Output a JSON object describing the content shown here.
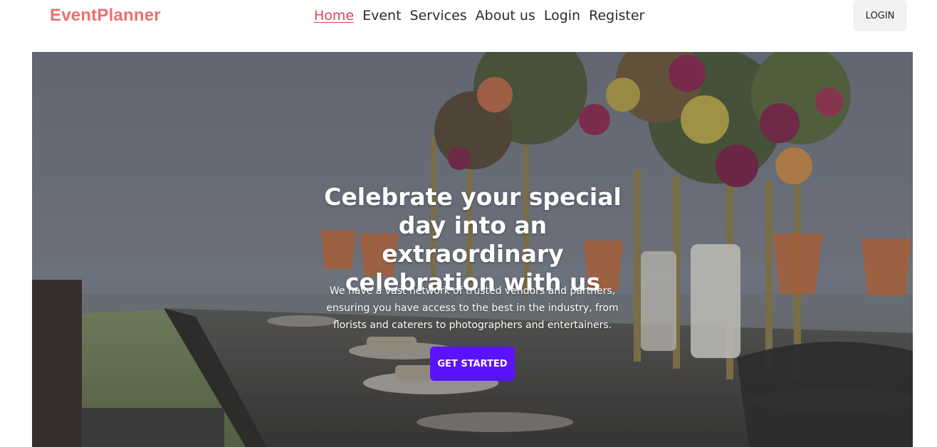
{
  "header": {
    "brand": "EventPlanner",
    "nav": [
      {
        "label": "Home",
        "active": true
      },
      {
        "label": "Event"
      },
      {
        "label": "Services"
      },
      {
        "label": "About us"
      },
      {
        "label": "Login"
      },
      {
        "label": "Register"
      }
    ],
    "login_button": "LOGIN"
  },
  "hero": {
    "title": "Celebrate your special day into an extraordinary celebration with us",
    "subtitle": "We have a vast network of trusted vendors and partners, ensuring you have access to the best in the industry, from florists and caterers to photographers and entertainers.",
    "cta_label": "GET STARTED"
  },
  "colors": {
    "brand": "#ef6f6f",
    "nav_active": "#e0445a",
    "cta": "#5a12ff",
    "login_bg": "#f2f2f2"
  }
}
